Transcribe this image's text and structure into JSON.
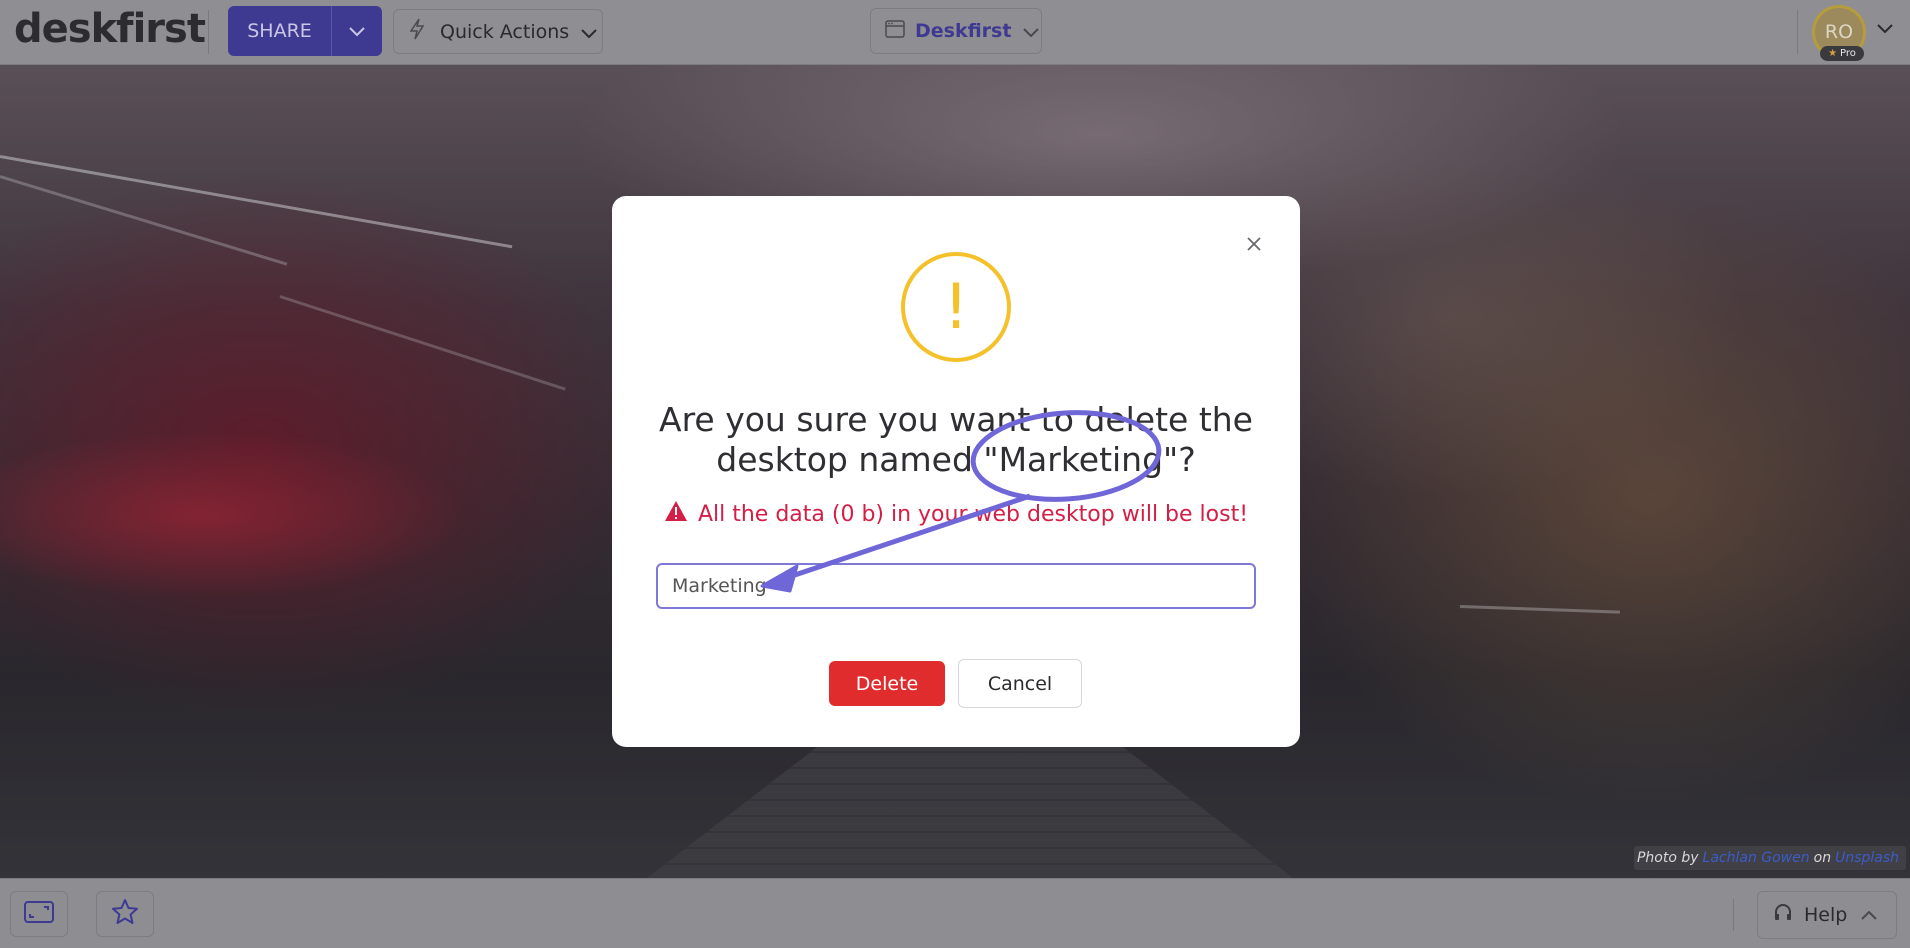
{
  "app": {
    "logo_text": "deskfirst"
  },
  "topbar": {
    "share_label": "SHARE",
    "quick_actions_label": "Quick Actions",
    "desktop_selector_label": "Deskfirst",
    "avatar_initials": "RO",
    "pro_badge_label": "Pro"
  },
  "dialog": {
    "question_line1": "Are you sure you want to delete the",
    "question_line2": "desktop named \"Marketing\"?",
    "warning_text": "All the data (0 b) in your web desktop will be lost!",
    "input_value": "Marketing",
    "delete_label": "Delete",
    "cancel_label": "Cancel",
    "warning_symbol": "!"
  },
  "bottombar": {
    "help_label": "Help"
  },
  "photo_credit": {
    "prefix": "Photo by",
    "author": "Lachlan Gowen",
    "middle": "on",
    "site": "Unsplash"
  },
  "colors": {
    "brand": "#3f3a91",
    "warning_icon": "#f5c12b",
    "danger": "#e02c2c",
    "warning_text": "#d41e45",
    "annotation": "#6f66d8"
  },
  "icons": {
    "share_dropdown": "chevron-down-icon",
    "quick_actions": "lightning-icon",
    "desktop": "desktop-window-icon",
    "close": "close-icon",
    "alert": "exclamation-circle-icon",
    "warning": "warning-triangle-icon",
    "fullscreen": "fullscreen-icon",
    "favorite": "star-icon",
    "help": "headset-icon"
  }
}
